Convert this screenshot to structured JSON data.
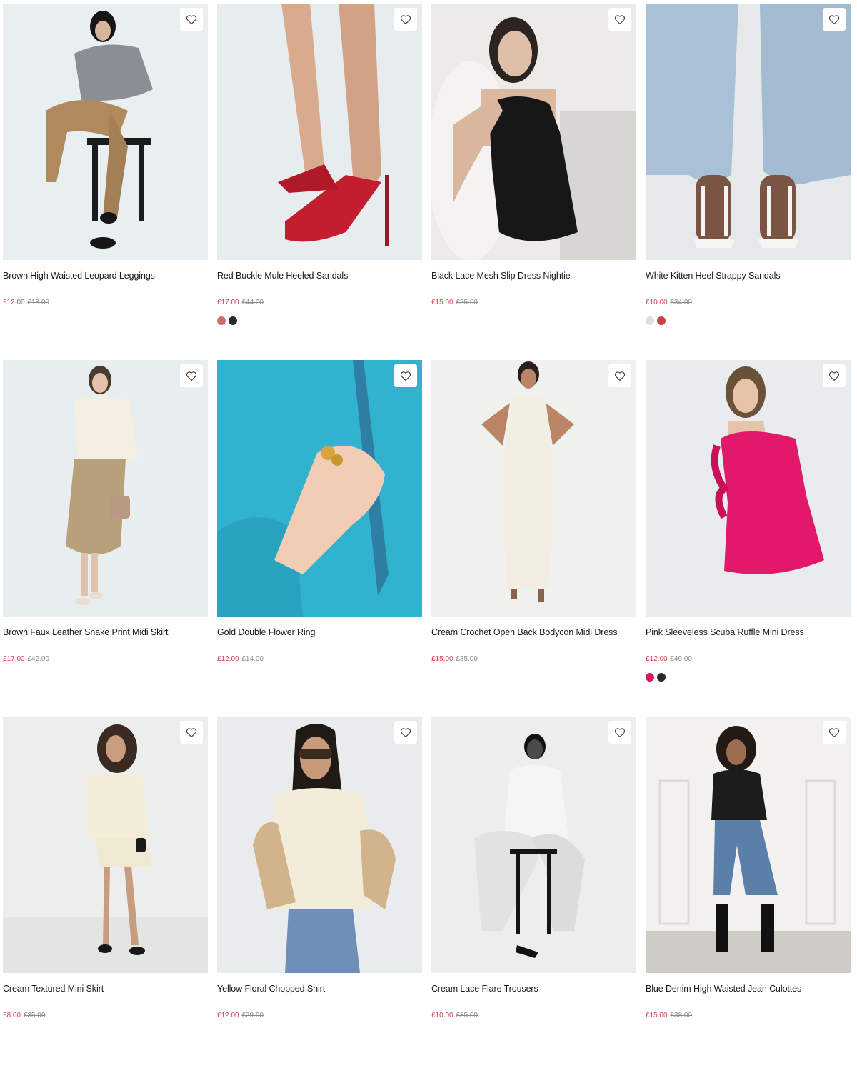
{
  "colors": {
    "sale_price": "#d0454f",
    "was_price": "#8b8b8b"
  },
  "wishlist_icon": "heart-outline-icon",
  "products": [
    {
      "name": "Brown High Waisted Leopard Leggings",
      "price": "£12.00",
      "was_price": "£18.00",
      "swatches": []
    },
    {
      "name": "Red Buckle Mule Heeled Sandals",
      "price": "£17.00",
      "was_price": "£44.00",
      "swatches": [
        "#c9706e",
        "#2a2a2a"
      ]
    },
    {
      "name": "Black Lace Mesh Slip Dress Nightie",
      "price": "£15.00",
      "was_price": "£25.00",
      "swatches": []
    },
    {
      "name": "White Kitten Heel Strappy Sandals",
      "price": "£10.00",
      "was_price": "£34.00",
      "swatches": [
        "#d9e2e0",
        "#c8414a"
      ]
    },
    {
      "name": "Brown Faux Leather Snake Print Midi Skirt",
      "price": "£17.00",
      "was_price": "£42.00",
      "swatches": []
    },
    {
      "name": "Gold Double Flower Ring",
      "price": "£12.00",
      "was_price": "£14.00",
      "swatches": []
    },
    {
      "name": "Cream Crochet Open Back Bodycon Midi Dress",
      "price": "£15.00",
      "was_price": "£35.00",
      "swatches": []
    },
    {
      "name": "Pink Sleeveless Scuba Ruffle Mini Dress",
      "price": "£12.00",
      "was_price": "£49.00",
      "swatches": [
        "#d41a5f",
        "#2a2a2a"
      ]
    },
    {
      "name": "Cream Textured Mini Skirt",
      "price": "£8.00",
      "was_price": "£35.00",
      "swatches": []
    },
    {
      "name": "Yellow Floral Chopped Shirt",
      "price": "£12.00",
      "was_price": "£29.00",
      "swatches": []
    },
    {
      "name": "Cream Lace Flare Trousers",
      "price": "£10.00",
      "was_price": "£35.00",
      "swatches": []
    },
    {
      "name": "Blue Denim High Waisted Jean Culottes",
      "price": "£15.00",
      "was_price": "£38.00",
      "swatches": []
    }
  ]
}
